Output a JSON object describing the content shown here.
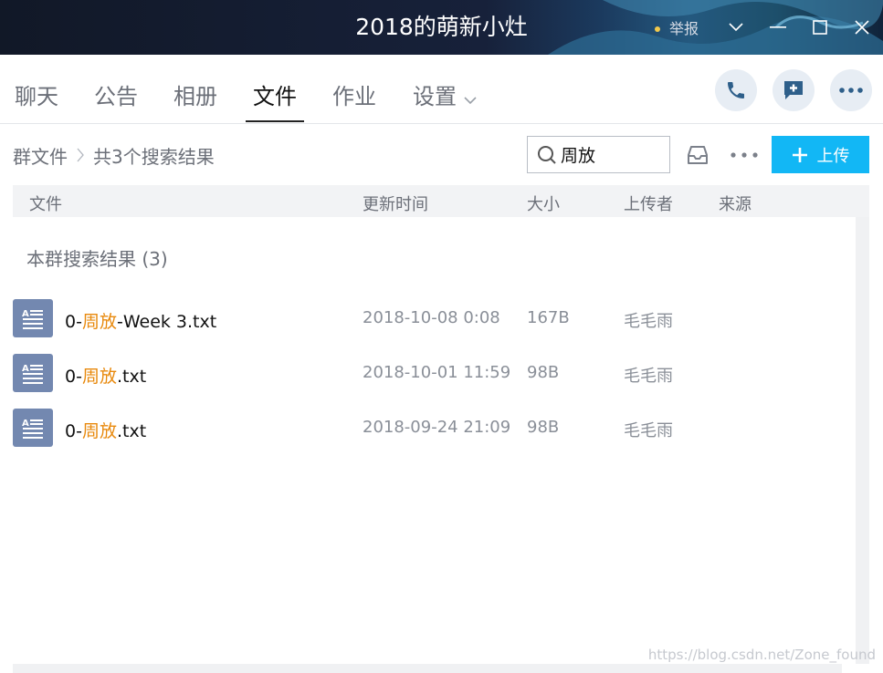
{
  "window": {
    "title": "2018的萌新小灶",
    "report_label": "举报"
  },
  "tabs": [
    {
      "label": "聊天",
      "active": false
    },
    {
      "label": "公告",
      "active": false
    },
    {
      "label": "相册",
      "active": false
    },
    {
      "label": "文件",
      "active": true
    },
    {
      "label": "作业",
      "active": false
    },
    {
      "label": "设置",
      "active": false
    }
  ],
  "actions": {
    "call_icon": "phone-icon",
    "message_icon": "message-plus-icon",
    "more_icon": "more-icon"
  },
  "breadcrumb": {
    "root": "群文件",
    "current": "共3个搜索结果"
  },
  "search": {
    "value": "周放"
  },
  "upload": {
    "label": "上传",
    "color": "#12b7f5"
  },
  "table": {
    "columns": [
      "文件",
      "更新时间",
      "大小",
      "上传者",
      "来源"
    ],
    "section_title": "本群搜索结果 (3)",
    "rows": [
      {
        "name_prefix": "0-",
        "name_highlight": "周放",
        "name_suffix": "-Week 3.txt",
        "time": "2018-10-08 0:08",
        "size": "167B",
        "uploader": "毛毛雨",
        "source": ""
      },
      {
        "name_prefix": "0-",
        "name_highlight": "周放",
        "name_suffix": ".txt",
        "time": "2018-10-01 11:59",
        "size": "98B",
        "uploader": "毛毛雨",
        "source": ""
      },
      {
        "name_prefix": "0-",
        "name_highlight": "周放",
        "name_suffix": ".txt",
        "time": "2018-09-24 21:09",
        "size": "98B",
        "uploader": "毛毛雨",
        "source": ""
      }
    ]
  },
  "watermark": "https://blog.csdn.net/Zone_found",
  "colors": {
    "highlight": "#e8890c",
    "file_icon": "#7388b0"
  }
}
